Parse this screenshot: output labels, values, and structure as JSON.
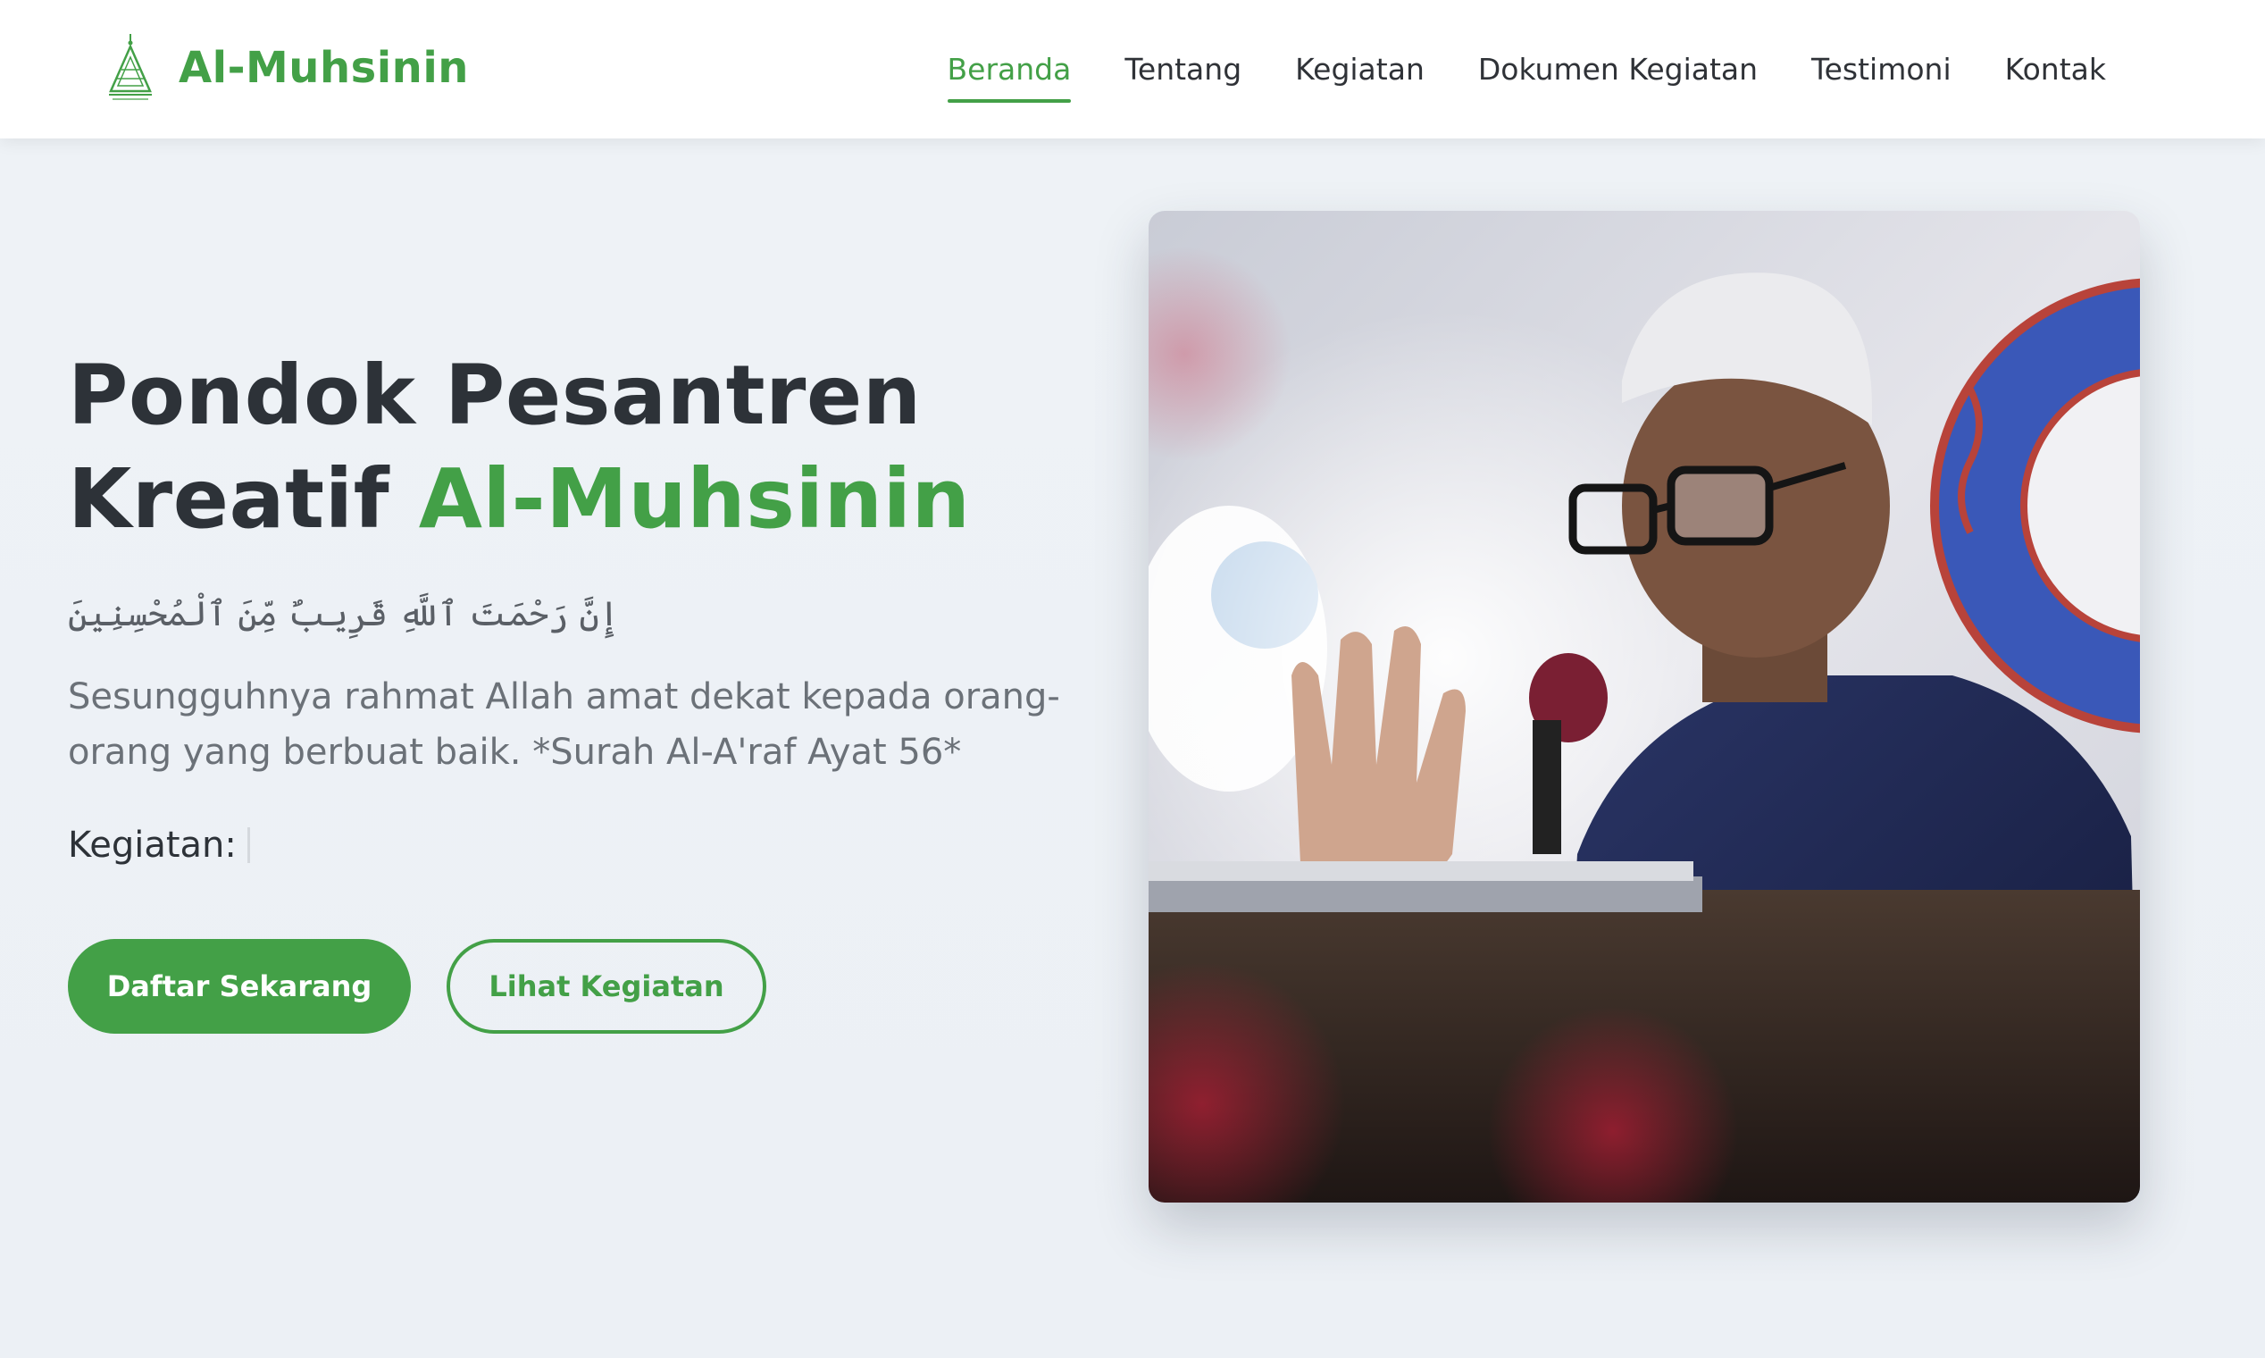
{
  "brand": {
    "name": "Al-Muhsinin",
    "logo_icon": "mosque-triangle-logo-icon"
  },
  "nav": {
    "items": [
      {
        "label": "Beranda",
        "active": true
      },
      {
        "label": "Tentang",
        "active": false
      },
      {
        "label": "Kegiatan",
        "active": false
      },
      {
        "label": "Dokumen Kegiatan",
        "active": false
      },
      {
        "label": "Testimoni",
        "active": false
      },
      {
        "label": "Kontak",
        "active": false
      }
    ]
  },
  "hero": {
    "title_line1": "Pondok Pesantren",
    "title_line2_prefix": "Kreatif ",
    "title_line2_accent": "Al-Muhsinin",
    "arabic_verse": "إِنَّ رَحْمَتَ ٱللَّهِ قَرِيبٌ مِّنَ ٱلْمُحْسِنِينَ",
    "quote": "Sesungguhnya rahmat Allah amat dekat kepada orang-orang yang berbuat baik. *Surah Al-A'raf Ayat 56*",
    "kegiatan_label": "Kegiatan:",
    "primary_button": "Daftar Sekarang",
    "secondary_button": "Lihat Kegiatan"
  },
  "colors": {
    "accent": "#43a047",
    "text_dark": "#2d3238",
    "text_muted": "#6b7178",
    "background": "#eef2f6"
  }
}
